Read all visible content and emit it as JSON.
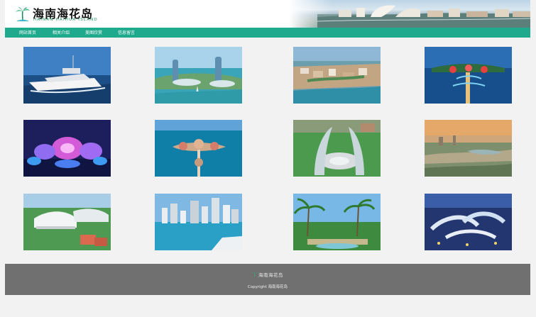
{
  "header": {
    "logo_cn": "海南海花岛",
    "logo_en": "HAINAN HAIHUA ISLAND"
  },
  "nav": {
    "items": [
      {
        "label": "网站首页"
      },
      {
        "label": "相关介绍"
      },
      {
        "label": "美图欣赏"
      },
      {
        "label": "信息留言"
      }
    ]
  },
  "gallery": {
    "images": [
      {
        "name": "yacht-photo"
      },
      {
        "name": "twin-towers-photo"
      },
      {
        "name": "island-resort-photo"
      },
      {
        "name": "night-bay-photo"
      },
      {
        "name": "lotus-lights-photo"
      },
      {
        "name": "flower-island-aerial-photo"
      },
      {
        "name": "arch-plaza-photo"
      },
      {
        "name": "sunset-coast-photo"
      },
      {
        "name": "white-domes-photo"
      },
      {
        "name": "city-skyline-photo"
      },
      {
        "name": "palm-garden-photo"
      },
      {
        "name": "blue-night-resort-photo"
      }
    ]
  },
  "footer": {
    "logo_text": "海南海花岛",
    "copyright": "Copyright 海南海花岛"
  }
}
